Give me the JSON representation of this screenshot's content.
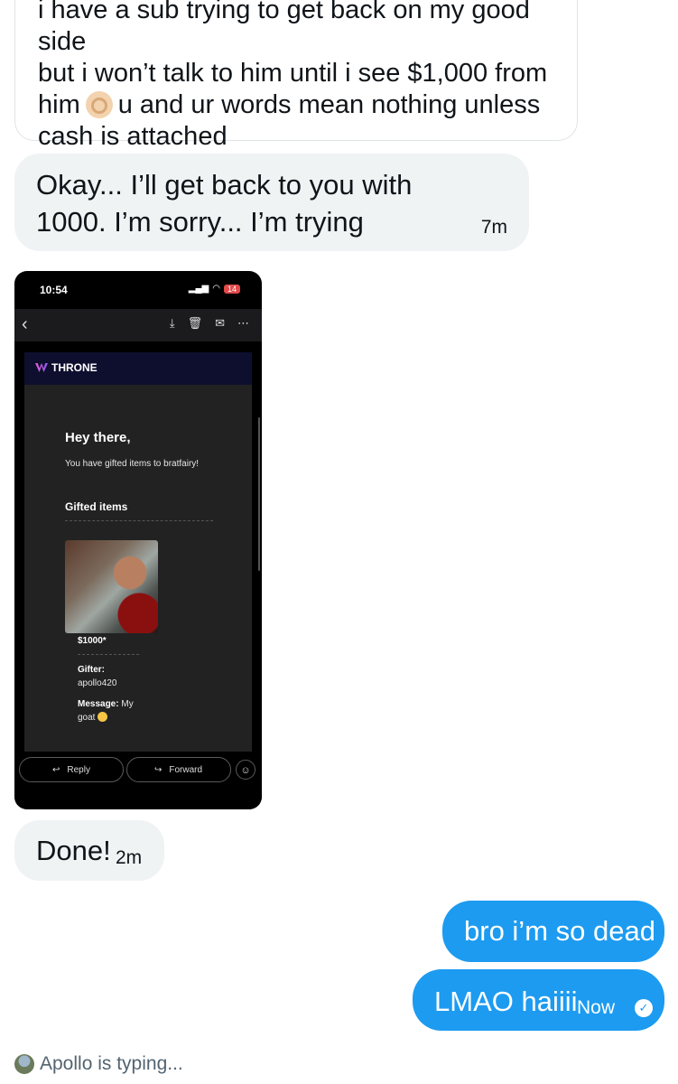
{
  "quoted_message": {
    "line1": "i have a sub trying to get back on my good side",
    "line2": "but i won’t talk to him until i see $1,000 from",
    "line3_pre": "him",
    "line3_post": "u and ur words mean nothing unless",
    "line4": "cash is attached"
  },
  "messages": [
    {
      "text": "Okay... I’ll get back to you with 1000. I’m sorry... I’m trying",
      "time": "7m"
    },
    {
      "text": "Done!",
      "time": "2m"
    },
    {
      "text": "bro i’m so dead"
    },
    {
      "text": "LMAO haiiii",
      "time": "Now"
    }
  ],
  "typing": "Apollo is typing...",
  "screenshot": {
    "status_time": "10:54",
    "battery": "14",
    "brand": "THRONE",
    "greeting": "Hey there,",
    "gift_message": "You have gifted items to bratfairy!",
    "gifted_items_title": "Gifted items",
    "price": "$1000*",
    "gifter_label": "Gifter:",
    "gifter_value": "apollo420",
    "message_label": "Message:",
    "message_value": "My goat",
    "reply_label": "Reply",
    "forward_label": "Forward"
  }
}
